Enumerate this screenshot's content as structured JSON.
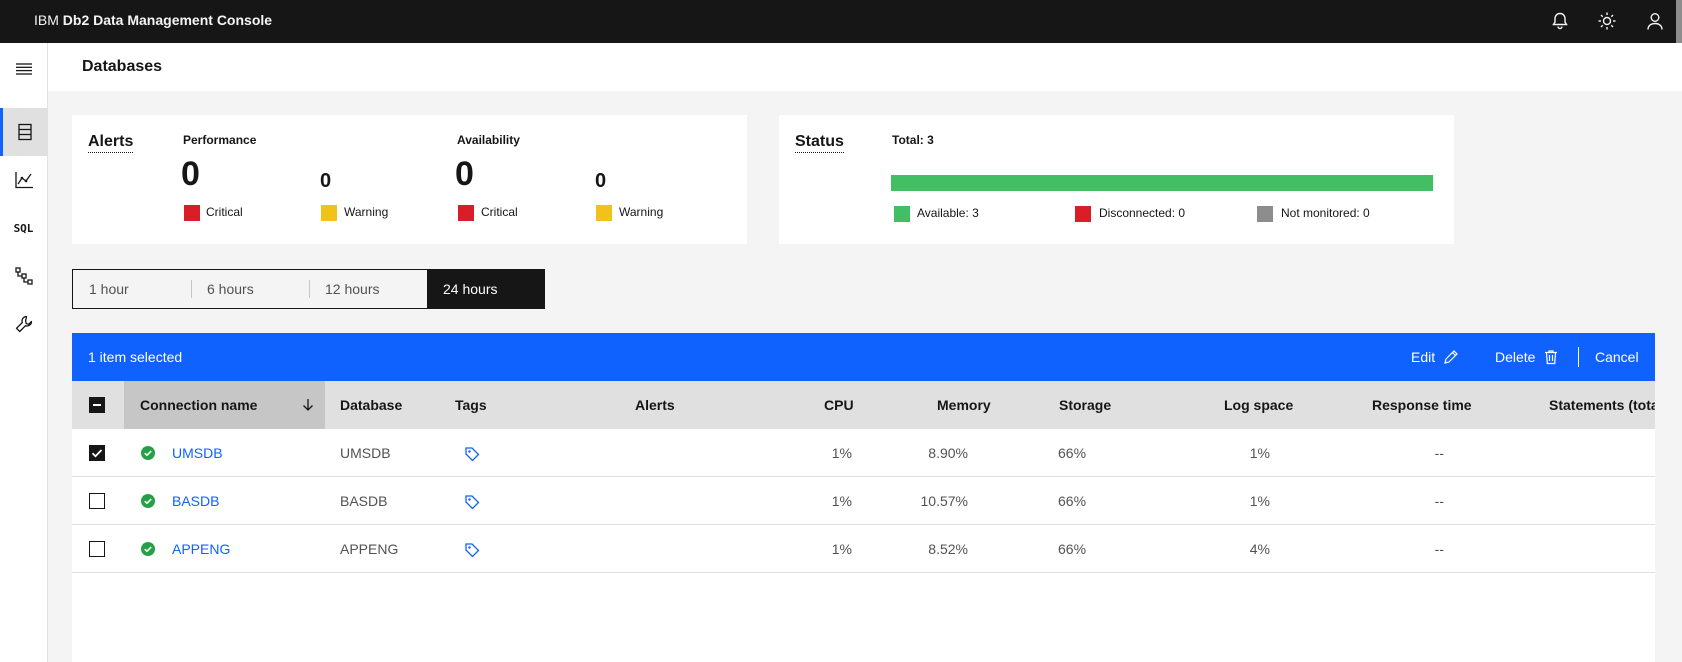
{
  "header": {
    "brand_prefix": "IBM",
    "brand_name": "Db2 Data Management Console",
    "icons": [
      "notification-icon",
      "theme-brightness-icon",
      "user-profile-icon"
    ]
  },
  "rail": {
    "icons": [
      "menu-icon",
      "database-icon",
      "monitor-chart-icon",
      "sql-icon",
      "hierarchy-icon",
      "wrench-icon"
    ],
    "sql_label": "SQL"
  },
  "page": {
    "title": "Databases"
  },
  "alerts": {
    "title": "Alerts",
    "performance": {
      "title": "Performance",
      "critical_count": "0",
      "warning_count": "0",
      "critical_label": "Critical",
      "warning_label": "Warning"
    },
    "availability": {
      "title": "Availability",
      "critical_count": "0",
      "warning_count": "0",
      "critical_label": "Critical",
      "warning_label": "Warning"
    }
  },
  "status": {
    "title": "Status",
    "total": "Total: 3",
    "available_fraction": 1.0,
    "legend": {
      "available": "Available: 3",
      "disconnected": "Disconnected: 0",
      "not_monitored": "Not monitored: 0"
    }
  },
  "time_range": {
    "options": [
      "1 hour",
      "6 hours",
      "12 hours",
      "24 hours"
    ],
    "selected": "24 hours"
  },
  "batch_actions": {
    "selected_text": "1 item selected",
    "edit": "Edit",
    "delete": "Delete",
    "cancel": "Cancel"
  },
  "table": {
    "headers": {
      "connection_name": "Connection name",
      "database": "Database",
      "tags": "Tags",
      "alerts": "Alerts",
      "cpu": "CPU",
      "memory": "Memory",
      "storage": "Storage",
      "log_space": "Log space",
      "response_time": "Response time",
      "statements": "Statements (tota"
    },
    "rows": [
      {
        "connection_name": "UMSDB",
        "database": "UMSDB",
        "cpu": "1%",
        "memory": "8.90%",
        "storage": "66%",
        "log_space": "1%",
        "response_time": "--",
        "checked": true
      },
      {
        "connection_name": "BASDB",
        "database": "BASDB",
        "cpu": "1%",
        "memory": "10.57%",
        "storage": "66%",
        "log_space": "1%",
        "response_time": "--",
        "checked": false
      },
      {
        "connection_name": "APPENG",
        "database": "APPENG",
        "cpu": "1%",
        "memory": "8.52%",
        "storage": "66%",
        "log_space": "4%",
        "response_time": "--",
        "checked": false
      }
    ]
  },
  "colors": {
    "critical": "#da1e28",
    "warning": "#f1c21b",
    "available": "#42be65",
    "not_monitored": "#8d8d8d",
    "accent": "#0f62fe",
    "healthy": "#24a148"
  }
}
